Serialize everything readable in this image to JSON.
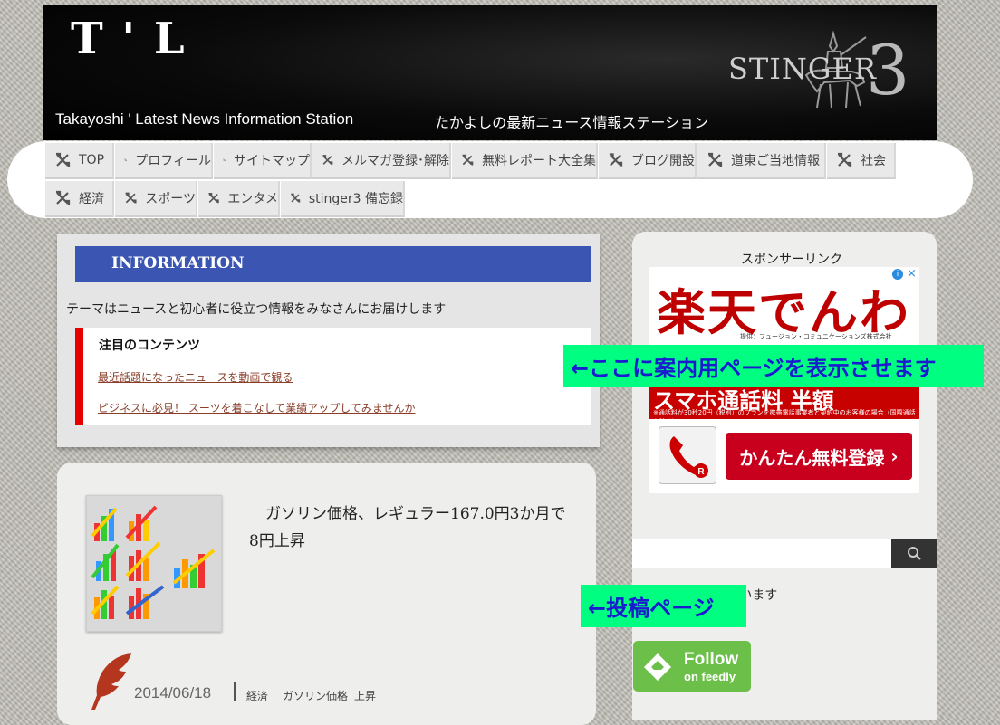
{
  "header": {
    "logo": "T ' L",
    "tagline_en": "Takayoshi ' Latest News Information Station",
    "tagline_ja": "たかよしの最新ニュース情報ステーション",
    "theme_logo": "STINGER",
    "theme_num": "3"
  },
  "nav": {
    "items": [
      {
        "label": "TOP"
      },
      {
        "label": "プロフィール"
      },
      {
        "label": "サイトマップ"
      },
      {
        "label": "メルマガ登録･解除"
      },
      {
        "label": "無料レポート大全集"
      },
      {
        "label": "ブログ開設"
      },
      {
        "label": "道東ご当地情報"
      },
      {
        "label": "社会"
      },
      {
        "label": "経済"
      },
      {
        "label": "スポーツ"
      },
      {
        "label": "エンタメ"
      },
      {
        "label": "stinger3 備忘録"
      }
    ]
  },
  "info": {
    "heading": "INFORMATION",
    "description": "テーマはニュースと初心者に役立つ情報をみなさんにお届けします",
    "featured_title": "注目のコンテンツ",
    "links": [
      "最近話題になったニュースを動画で観る",
      "ビジネスに必見！ スーツを着こなして業績アップしてみませんか"
    ]
  },
  "post": {
    "title": "ガソリン価格、レギュラー167.0円3か月で8円上昇",
    "date": "2014/06/18",
    "tags": [
      "経済",
      "ガソリン価格",
      "上昇"
    ]
  },
  "sidebar": {
    "sponsor_label": "スポンサーリンク",
    "ad": {
      "title": "楽天でんわ",
      "provider": "提供：フュージョン・コミュニケーションズ株式会社",
      "band_text": "スマホ通話料 半額",
      "small_text": "※通話料が30秒20円（税別）のプランを携帯電話事業者と契約中のお客様の場合（国際通話を除く）",
      "cta": "かんたん無料登録",
      "info_icon": "i",
      "close_icon": "×"
    },
    "search": {
      "value": "",
      "placeholder": ""
    },
    "notify_text": "報をお知らせしています",
    "feedly": {
      "line1": "Follow",
      "line2": "on feedly"
    }
  },
  "annotations": {
    "info_page": "←ここに案内用ページを表示させます",
    "post_page": "←投稿ページ"
  },
  "colors": {
    "info_heading_bg": "#3a56b2",
    "featured_accent": "#e80000",
    "annotation_bg": "#00ff80",
    "annotation_text": "#1a1ad0",
    "feedly_green": "#6cc04a",
    "ad_red": "#c70000"
  }
}
